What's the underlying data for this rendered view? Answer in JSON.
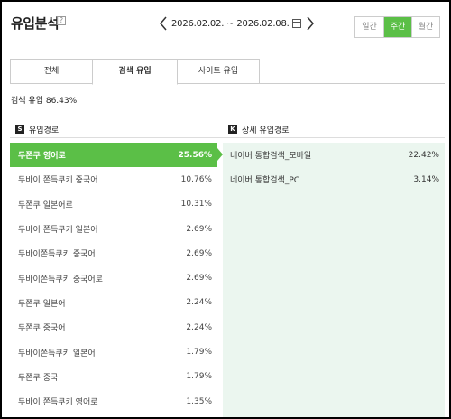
{
  "header": {
    "title": "유입분석",
    "help": "?",
    "date_range": "2026.02.02. ~ 2026.02.08.",
    "period_buttons": [
      {
        "label": "일간",
        "active": false
      },
      {
        "label": "주간",
        "active": true
      },
      {
        "label": "월간",
        "active": false
      }
    ]
  },
  "tabs": [
    {
      "label": "전체",
      "active": false
    },
    {
      "label": "검색 유입",
      "active": true
    },
    {
      "label": "사이트 유입",
      "active": false
    }
  ],
  "summary": "검색 유입 86.43%",
  "left_section": {
    "badge": "S",
    "title": "유입경로"
  },
  "right_section": {
    "badge": "K",
    "title": "상세 유입경로"
  },
  "sources": [
    {
      "label": "두쫀쿠 영어로",
      "value": "25.56%",
      "selected": true
    },
    {
      "label": "두바이 쫀득쿠키 중국어",
      "value": "10.76%"
    },
    {
      "label": "두쫀쿠 일본어로",
      "value": "10.31%"
    },
    {
      "label": "두바이 쫀득쿠키 일본어",
      "value": "2.69%"
    },
    {
      "label": "두바이쫀득쿠키 중국어",
      "value": "2.69%"
    },
    {
      "label": "두바이쫀득쿠키 중국어로",
      "value": "2.69%"
    },
    {
      "label": "두쫀쿠 일본어",
      "value": "2.24%"
    },
    {
      "label": "두쫀쿠 중국어",
      "value": "2.24%"
    },
    {
      "label": "두바이쫀득쿠키 일본어",
      "value": "1.79%"
    },
    {
      "label": "두쫀쿠 중국",
      "value": "1.79%"
    },
    {
      "label": "두바이 쫀득쿠키 영어로",
      "value": "1.35%"
    }
  ],
  "details": [
    {
      "label": "네이버 통합검색_모바일",
      "value": "22.42%"
    },
    {
      "label": "네이버 통합검색_PC",
      "value": "3.14%"
    }
  ],
  "colors": {
    "accent": "#5bbf47",
    "detail_bg": "#ebf6ef"
  }
}
